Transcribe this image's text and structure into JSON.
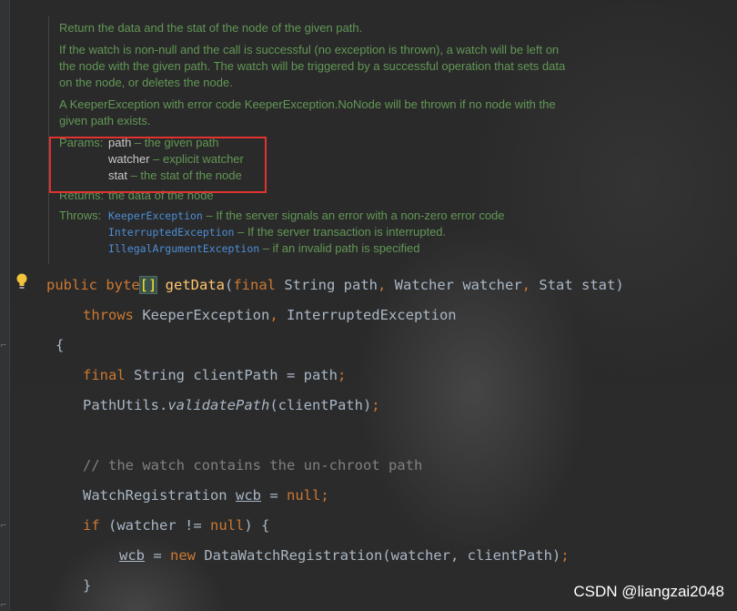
{
  "javadoc": {
    "summary": "Return the data and the stat of the node of the given path.",
    "watch_note_1": "If the watch is non-null and the call is successful (no exception is thrown), a watch will be left on",
    "watch_note_2": "the node with the given path. The watch will be triggered by a successful operation that sets data",
    "watch_note_3": "on the node, or deletes the node.",
    "exception_note_1": "A KeeperException with error code KeeperException.NoNode will be thrown if no node with the",
    "exception_note_2": "given path exists.",
    "params_label": "Params:",
    "params": [
      {
        "name": "path",
        "desc": " – the given path"
      },
      {
        "name": "watcher",
        "desc": " – explicit watcher"
      },
      {
        "name": "stat",
        "desc": " – the stat of the node"
      }
    ],
    "returns_label": "Returns:",
    "returns_text": "the data of the node",
    "throws_label": "Throws:",
    "throws": [
      {
        "name": "KeeperException",
        "desc": " – If the server signals an error with a non-zero error code"
      },
      {
        "name": "InterruptedException",
        "desc": " – If the server transaction is interrupted."
      },
      {
        "name": "IllegalArgumentException",
        "desc": " – if an invalid path is specified"
      }
    ]
  },
  "code": {
    "l1_public": "public ",
    "l1_byte": "byte",
    "l1_brackets": "[]",
    "l1_method": "getData",
    "l1_paren": "(",
    "l1_final": "final ",
    "l1_p1": "String path",
    "l1_comma1": ", ",
    "l1_p2": "Watcher watcher",
    "l1_comma2": ", ",
    "l1_p3": "Stat stat)",
    "l2_throws": "throws ",
    "l2_e1": "KeeperException",
    "l2_comma": ", ",
    "l2_e2": "InterruptedException",
    "l3": "{",
    "l4_final": "final ",
    "l4_rest": "String clientPath = path",
    "l4_semi": ";",
    "l5_pre": "PathUtils.",
    "l5_method": "validatePath",
    "l5_post": "(clientPath)",
    "l5_semi": ";",
    "l7": "// the watch contains the un-chroot path",
    "l8_type": "WatchRegistration ",
    "l8_var": "wcb",
    "l8_eq": " = ",
    "l8_null": "null",
    "l8_semi": ";",
    "l9_if": "if ",
    "l9_cond": "(watcher != ",
    "l9_null": "null",
    "l9_post": ") {",
    "l10_var": "wcb",
    "l10_eq": " = ",
    "l10_new": "new ",
    "l10_rest": "DataWatchRegistration(watcher, clientPath)",
    "l10_semi": ";",
    "l11": "}"
  },
  "watermark": "CSDN @liangzai2048",
  "colors": {
    "keyword": "#cc7832",
    "method": "#ffc66d",
    "doc_text": "#629755",
    "highlight_border": "#e0322e"
  },
  "icons": [
    "lightbulb-icon",
    "fold-marker-icon"
  ]
}
